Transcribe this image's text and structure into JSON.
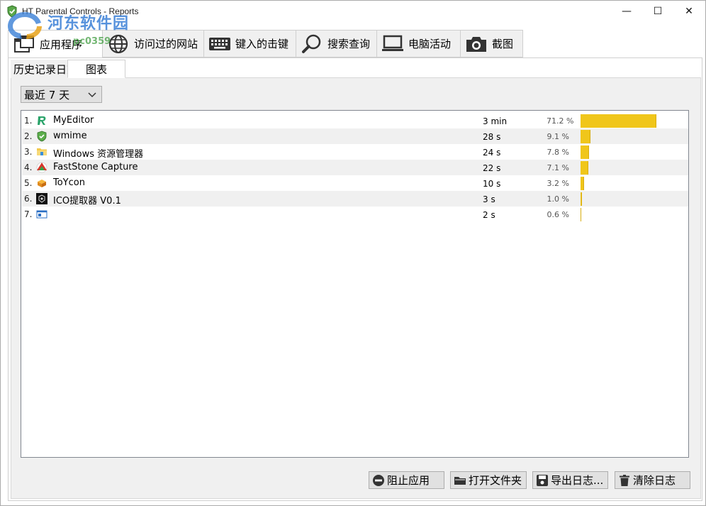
{
  "window": {
    "title": "HT Parental Controls - Reports",
    "controls": {
      "minimize": "—",
      "maximize": "☐",
      "close": "✕"
    }
  },
  "watermark": {
    "text": "河东软件园",
    "url": "pc0359"
  },
  "main_tabs": [
    {
      "label": "应用程序",
      "icon": "apps-icon",
      "active": true
    },
    {
      "label": "访问过的网站",
      "icon": "globe-icon"
    },
    {
      "label": "键入的击键",
      "icon": "keyboard-icon"
    },
    {
      "label": "搜索查询",
      "icon": "magnifier-icon"
    },
    {
      "label": "电脑活动",
      "icon": "laptop-icon"
    },
    {
      "label": "截图",
      "icon": "camera-icon"
    }
  ],
  "sub_tabs": [
    {
      "label": "历史记录日志"
    },
    {
      "label": "图表",
      "active": true
    }
  ],
  "range_select": {
    "value": "最近 7 天"
  },
  "app_list": [
    {
      "num": "1.",
      "name": "MyEditor",
      "duration": "3 min",
      "percent": "71.2 %",
      "share": 71.2,
      "icon": "myeditor-icon"
    },
    {
      "num": "2.",
      "name": "wmime",
      "duration": "28 s",
      "percent": "9.1 %",
      "share": 9.1,
      "icon": "shield-icon"
    },
    {
      "num": "3.",
      "name": "Windows 资源管理器",
      "duration": "24 s",
      "percent": "7.8 %",
      "share": 7.8,
      "icon": "folder-icon"
    },
    {
      "num": "4.",
      "name": "FastStone Capture",
      "duration": "22 s",
      "percent": "7.1 %",
      "share": 7.1,
      "icon": "faststone-icon"
    },
    {
      "num": "5.",
      "name": "ToYcon",
      "duration": "10 s",
      "percent": "3.2 %",
      "share": 3.2,
      "icon": "toycon-icon"
    },
    {
      "num": "6.",
      "name": "ICO提取器 V0.1",
      "duration": "3 s",
      "percent": "1.0 %",
      "share": 1.0,
      "icon": "ico-extractor-icon"
    },
    {
      "num": "7.",
      "name": "",
      "duration": "2 s",
      "percent": "0.6 %",
      "share": 0.6,
      "icon": "window-icon"
    }
  ],
  "buttons": {
    "block_app": "阻止应用",
    "open_folder": "打开文件夹",
    "export_log": "导出日志...",
    "clear_log": "清除日志"
  },
  "colors": {
    "bar": "#f0c61a",
    "accent": "#3a7fd6"
  }
}
